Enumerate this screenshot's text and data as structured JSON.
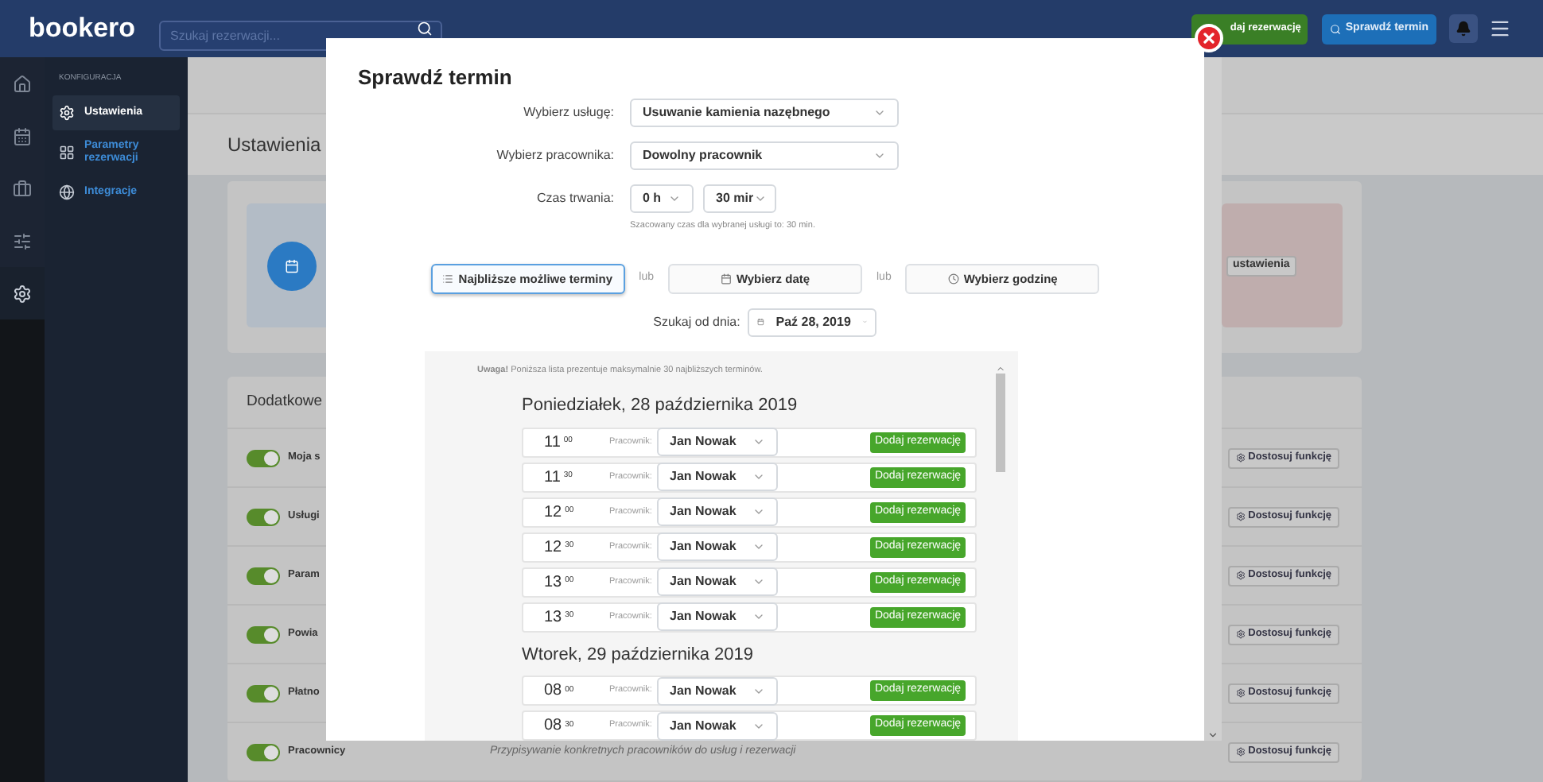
{
  "header": {
    "logo": "bookero",
    "search": {
      "placeholder": "Szukaj rezerwacji..."
    },
    "add_button": "daj rezerwację",
    "check_button": "Sprawdź termin"
  },
  "rail": [
    {
      "selected": false
    },
    {
      "selected": false
    },
    {
      "selected": false
    },
    {
      "selected": false
    },
    {
      "selected": true
    }
  ],
  "sidebar": {
    "heading": "KONFIGURACJA",
    "items": [
      {
        "label": "Ustawienia",
        "selected": true
      },
      {
        "label": "Parametry rezerwacji",
        "selected": false
      },
      {
        "label": "Integracje",
        "selected": false
      }
    ]
  },
  "page": {
    "title": "Ustawienia",
    "settings_button": "ustawienia",
    "section_title": "Dodatkowe",
    "features": [
      {
        "label": "Moja s",
        "on": true,
        "button": "Dostosuj funkcję"
      },
      {
        "label": "Usługi",
        "on": true,
        "button": "Dostosuj funkcję"
      },
      {
        "label": "Param",
        "on": true,
        "button": "Dostosuj funkcję"
      },
      {
        "label": "Powia",
        "on": true,
        "button": "Dostosuj funkcję"
      },
      {
        "label": "Płatno",
        "on": true,
        "button": "Dostosuj funkcję"
      },
      {
        "label": "Pracownicy",
        "description": "Przypisywanie konkretnych pracowników do usług i rezerwacji",
        "on": true,
        "button": "Dostosuj funkcję"
      }
    ]
  },
  "modal": {
    "title": "Sprawdź termin",
    "service": {
      "label": "Wybierz usługę:",
      "value": "Usuwanie kamienia nazębnego"
    },
    "employee": {
      "label": "Wybierz pracownika:",
      "value": "Dowolny pracownik"
    },
    "duration": {
      "label": "Czas trwania:",
      "hours": "0 h",
      "minutes": "30 mir",
      "hint": "Szacowany czas dla wybranej usługi to: 30 min."
    },
    "modes": [
      {
        "label": "Najbliższe możliwe terminy",
        "selected": true
      },
      {
        "label": "Wybierz datę",
        "selected": false
      },
      {
        "label": "Wybierz godzinę",
        "selected": false
      }
    ],
    "separators": [
      "lub",
      "lub"
    ],
    "search_from": {
      "label": "Szukaj od dnia:",
      "value": "Paź 28, 2019"
    },
    "notice": "**Uwaga!** Poniższa lista prezentuje maksymalnie 30 najbliższych terminów.",
    "days": [
      {
        "title": "Poniedziałek, 28 października 2019",
        "slots": [
          {
            "hour": "11",
            "minutes": "00",
            "employee_label": "Pracownik:",
            "employee": "Jan Nowak",
            "button": "Dodaj rezerwację"
          },
          {
            "hour": "11",
            "minutes": "30",
            "employee_label": "Pracownik:",
            "employee": "Jan Nowak",
            "button": "Dodaj rezerwację"
          },
          {
            "hour": "12",
            "minutes": "00",
            "employee_label": "Pracownik:",
            "employee": "Jan Nowak",
            "button": "Dodaj rezerwację"
          },
          {
            "hour": "12",
            "minutes": "30",
            "employee_label": "Pracownik:",
            "employee": "Jan Nowak",
            "button": "Dodaj rezerwację"
          },
          {
            "hour": "13",
            "minutes": "00",
            "employee_label": "Pracownik:",
            "employee": "Jan Nowak",
            "button": "Dodaj rezerwację"
          },
          {
            "hour": "13",
            "minutes": "30",
            "employee_label": "Pracownik:",
            "employee": "Jan Nowak",
            "button": "Dodaj rezerwację"
          }
        ]
      },
      {
        "title": "Wtorek, 29 października 2019",
        "slots": [
          {
            "hour": "08",
            "minutes": "00",
            "employee_label": "Pracownik:",
            "employee": "Jan Nowak",
            "button": "Dodaj rezerwację"
          },
          {
            "hour": "08",
            "minutes": "30",
            "employee_label": "Pracownik:",
            "employee": "Jan Nowak",
            "button": "Dodaj rezerwację"
          }
        ]
      }
    ]
  }
}
